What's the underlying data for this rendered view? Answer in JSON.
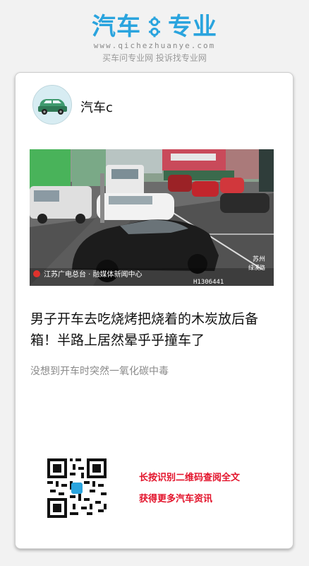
{
  "brand": {
    "name_left": "汽车",
    "name_right": "专业",
    "url": "www.qichezhuanye.com",
    "slogan": "买车问专业网  投诉找专业网",
    "color": "#2aa4de"
  },
  "post": {
    "author": "汽车c",
    "title": "男子开车去吃烧烤把烧着的木炭放后备箱！半路上居然晕乎乎撞车了",
    "subtitle": "没想到开车时突然一氧化碳中毒",
    "thumbnail_watermark": "江苏广电总台 · 融媒体新闻中心",
    "thumbnail_timestamp": "H1306441",
    "thumbnail_label_top": "苏州",
    "thumbnail_label_right": "绿溪路"
  },
  "footer": {
    "qr_icon": "qr-code-icon",
    "cta_line1": "长按识别二维码查阅全文",
    "cta_line2": "获得更多汽车资讯",
    "cta_color": "#e3122a"
  }
}
